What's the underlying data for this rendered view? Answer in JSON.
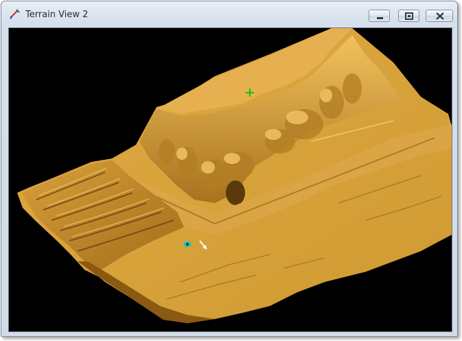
{
  "window": {
    "title": "Terrain View 2"
  },
  "icons": {
    "app": "pencil-terrain-icon",
    "minimize": "minimize-icon",
    "maximize": "maximize-icon",
    "close": "close-icon",
    "green_marker": "crosshair-marker-icon",
    "cyan_marker": "camera-target-icon",
    "white_arrow": "direction-arrow-icon"
  },
  "colors": {
    "viewport_background": "#000000",
    "terrain": "#d9a23a",
    "terrain_shadow": "#8a5a12",
    "terrain_highlight": "#f0c060",
    "marker_green": "#00c800",
    "marker_cyan": "#00c8c8"
  }
}
